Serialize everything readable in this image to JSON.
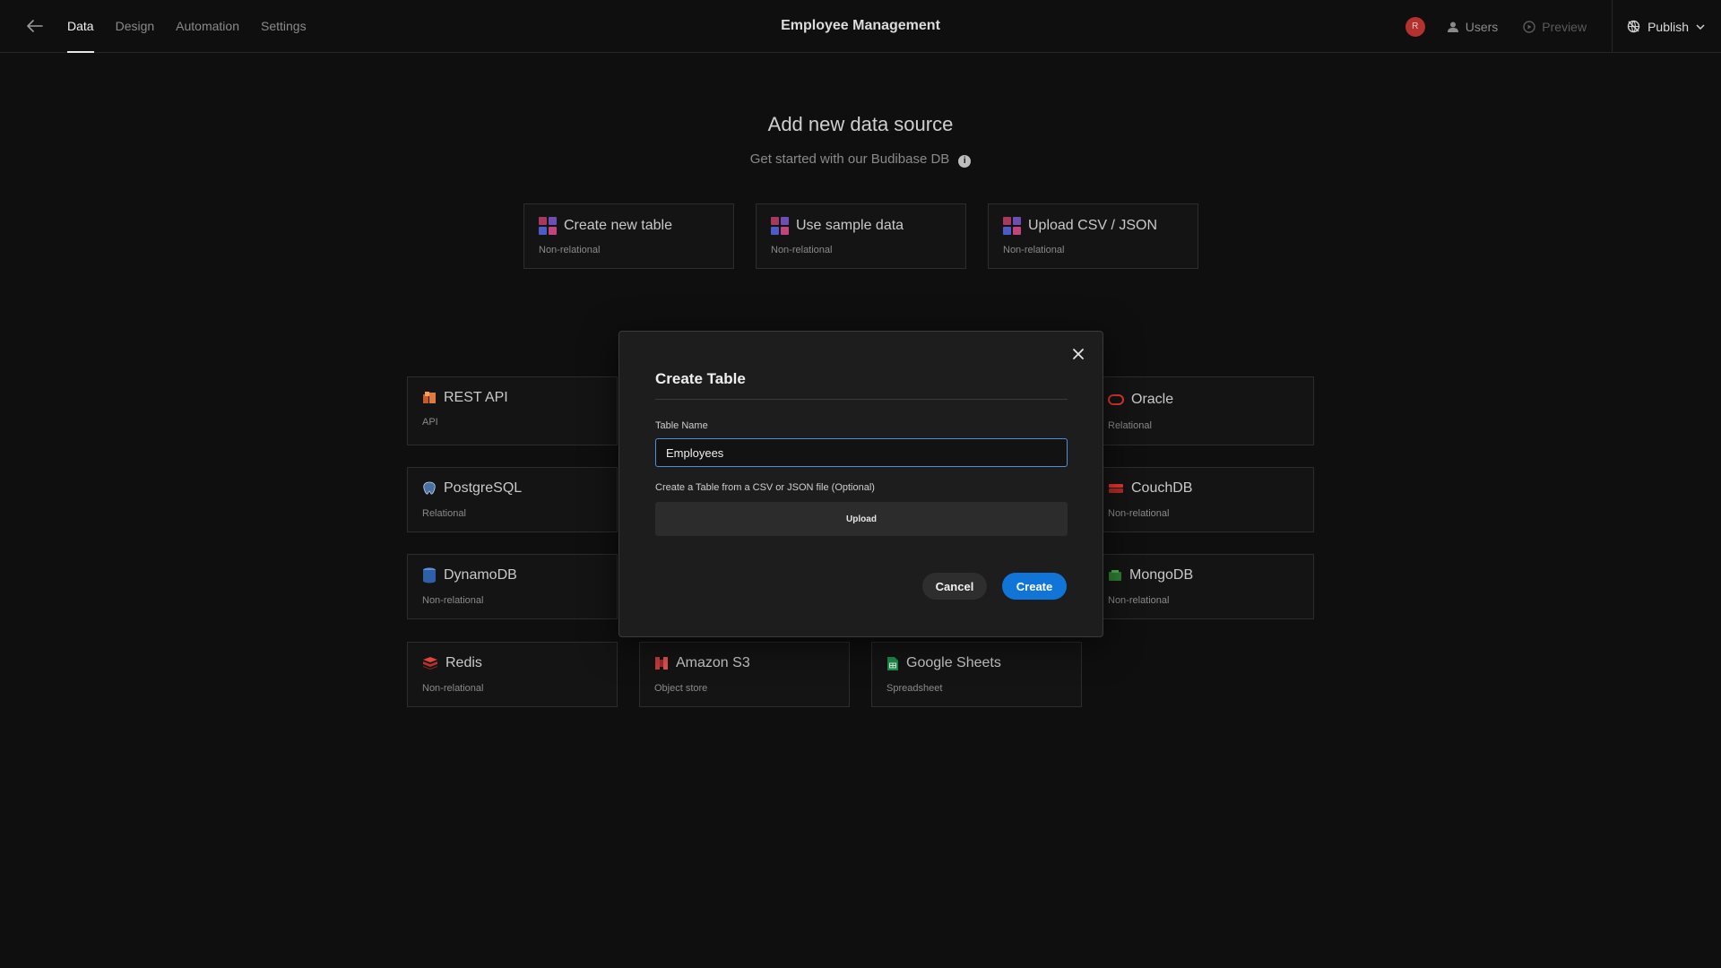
{
  "topbar": {
    "tabs": [
      {
        "label": "Data",
        "active": true
      },
      {
        "label": "Design",
        "active": false
      },
      {
        "label": "Automation",
        "active": false
      },
      {
        "label": "Settings",
        "active": false
      }
    ],
    "title": "Employee Management",
    "avatar_initial": "R",
    "users_label": "Users",
    "preview_label": "Preview",
    "publish_label": "Publish"
  },
  "main": {
    "heading": "Add new data source",
    "subheading": "Get started with our Budibase DB",
    "info_glyph": "i",
    "internal_cards": [
      {
        "title": "Create new table",
        "sub": "Non-relational",
        "icon": "budibase-icon"
      },
      {
        "title": "Use sample data",
        "sub": "Non-relational",
        "icon": "budibase-icon"
      },
      {
        "title": "Upload CSV / JSON",
        "sub": "Non-relational",
        "icon": "budibase-icon"
      }
    ],
    "sources": [
      {
        "title": "REST API",
        "sub": "API",
        "icon": "rest-api-icon"
      },
      {
        "title": "Oracle",
        "sub": "Relational",
        "icon": "oracle-icon"
      },
      {
        "title": "PostgreSQL",
        "sub": "Relational",
        "icon": "postgresql-icon"
      },
      {
        "title": "CouchDB",
        "sub": "Non-relational",
        "icon": "couchdb-icon"
      },
      {
        "title": "DynamoDB",
        "sub": "Non-relational",
        "icon": "dynamodb-icon"
      },
      {
        "title": "MongoDB",
        "sub": "Non-relational",
        "icon": "mongodb-icon"
      },
      {
        "title": "Redis",
        "sub": "Non-relational",
        "icon": "redis-icon"
      },
      {
        "title": "Amazon S3",
        "sub": "Object store",
        "icon": "amazon-s3-icon"
      },
      {
        "title": "Google Sheets",
        "sub": "Spreadsheet",
        "icon": "google-sheets-icon"
      }
    ]
  },
  "modal": {
    "title": "Create Table",
    "table_name_label": "Table Name",
    "table_name_value": "Employees",
    "file_label": "Create a Table from a CSV or JSON file (Optional)",
    "upload_label": "Upload",
    "cancel_label": "Cancel",
    "create_label": "Create"
  },
  "colors": {
    "background": "#0f0f0f",
    "modal_bg": "#1d1d1d",
    "primary_button": "#1175d8",
    "input_focus_border": "#4a8fe0",
    "avatar_bg": "#b3322d"
  }
}
